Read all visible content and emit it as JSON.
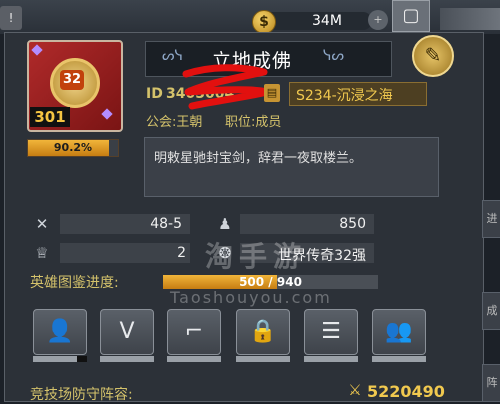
{
  "topbar": {
    "avatar_glyph": "!",
    "coin_value": "34M",
    "coin_symbol": "$",
    "close_glyph": "▢"
  },
  "profile": {
    "avatar_level": "32",
    "player_level": "301",
    "exp_percent_text": "90.2%",
    "exp_fraction": 0.902,
    "name_deco_left": "ᔕᓭ",
    "name_deco_right": "ᓭᔕ",
    "player_name": "立地成佛",
    "edit_glyph": "✎",
    "id_label": "ID",
    "id_value": " 3405004",
    "copy_glyph": "▤",
    "server": "S234-沉浸之海",
    "guild_label": "公会:",
    "guild_name": "王朝",
    "rank_label": "职位:",
    "rank_name": "成员",
    "signature": "明敕星驰封宝剑，辞君一夜取楼兰。"
  },
  "side_tabs": [
    "进",
    "成",
    "阵"
  ],
  "stats": {
    "kd_icon": "✕",
    "kd_value": "48-5",
    "rank_icon": "♟",
    "rank_value": "850",
    "trophy_icon": "♕",
    "trophy_value": "2",
    "title_icon": "❂",
    "title_value": "世界传奇32强"
  },
  "heroes": {
    "label": "英雄图鉴进度:",
    "progress_text": "500 / 940",
    "progress_fraction": 0.532
  },
  "watermark": {
    "cn": "淘手游",
    "en": "Taoshouyou.com"
  },
  "func_buttons": [
    {
      "name": "person-icon",
      "glyph": "👤"
    },
    {
      "name": "vip-icon",
      "glyph": "Ⅴ"
    },
    {
      "name": "pistol-icon",
      "glyph": "⌐"
    },
    {
      "name": "lock-icon",
      "glyph": "🔒"
    },
    {
      "name": "document-icon",
      "glyph": "☰"
    },
    {
      "name": "group-icon",
      "glyph": "👥"
    }
  ],
  "arena": {
    "label": "竞技场防守阵容:",
    "icon": "⚔",
    "power": "5220490"
  },
  "colors": {
    "gold_text": "#d4c26b",
    "panel_bg": "#2c3138",
    "accent_orange": "#f1b53a",
    "scribble_red": "#e2100f"
  }
}
